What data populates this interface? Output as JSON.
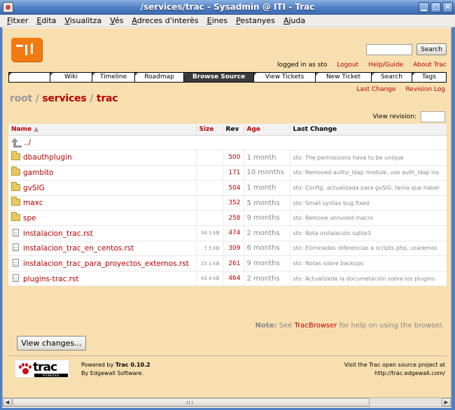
{
  "window": {
    "title": "/services/trac - Sysadmin @ ITI - Trac"
  },
  "menubar": {
    "items": [
      {
        "label": "Fitxer"
      },
      {
        "label": "Edita"
      },
      {
        "label": "Visualitza"
      },
      {
        "label": "Vés"
      },
      {
        "label": "Adreces d'interès"
      },
      {
        "label": "Eines"
      },
      {
        "label": "Pestanyes"
      },
      {
        "label": "Ajuda"
      }
    ]
  },
  "search": {
    "value": "",
    "button_label": "Search"
  },
  "metanav": {
    "logged_in": "logged in as sto",
    "logout": "Logout",
    "help": "Help/Guide",
    "about": "About Trac"
  },
  "mainnav": {
    "items": [
      {
        "label": ""
      },
      {
        "label": "Wiki"
      },
      {
        "label": "Timeline"
      },
      {
        "label": "Roadmap"
      },
      {
        "label": "Browse Source"
      },
      {
        "label": "View Tickets"
      },
      {
        "label": "New Ticket"
      },
      {
        "label": "Search"
      },
      {
        "label": "Tags"
      }
    ],
    "active_index": 4
  },
  "ctxnav": {
    "last_change": "Last Change",
    "revision_log": "Revision Log"
  },
  "path": {
    "root": "root",
    "sep1": "/",
    "part1": "services",
    "sep2": "/",
    "part2": "trac"
  },
  "view_revision": {
    "label": "View revision:",
    "value": ""
  },
  "listing": {
    "headers": {
      "name": "Name",
      "sort_indicator": "▲",
      "size": "Size",
      "rev": "Rev",
      "age": "Age",
      "change": "Last Change"
    },
    "parent": "../",
    "rows": [
      {
        "type": "dir",
        "name": "dbauthplugin",
        "size": "",
        "rev": "500",
        "age": "1 month",
        "change": "sto: The permissions have to be unique"
      },
      {
        "type": "dir",
        "name": "gambito",
        "size": "",
        "rev": "171",
        "age": "10 months",
        "change": "sto: Removed authz_ldap module, use auth_ldap ins"
      },
      {
        "type": "dir",
        "name": "gvSIG",
        "size": "",
        "rev": "504",
        "age": "1 month",
        "change": "sto: Config. actualizada para gvSIG, tenía que haber"
      },
      {
        "type": "dir",
        "name": "maxc",
        "size": "",
        "rev": "352",
        "age": "5 months",
        "change": "sto: Small syntax bug fixed"
      },
      {
        "type": "dir",
        "name": "spe",
        "size": "",
        "rev": "258",
        "age": "9 months",
        "change": "sto: Remove unnused macro"
      },
      {
        "type": "file",
        "name": "instalacion_trac.rst",
        "size": "34.3 kB",
        "rev": "474",
        "age": "2 months",
        "change": "sto: Nota instalación sqlite3"
      },
      {
        "type": "file",
        "name": "instalacion_trac_en_centos.rst",
        "size": "7.5 kB",
        "rev": "309",
        "age": "6 months",
        "change": "sto: Eliminadas referencias a scripts php, usaremos"
      },
      {
        "type": "file",
        "name": "instalacion_trac_para_proyectos_externos.rst",
        "size": "15.1 kB",
        "rev": "261",
        "age": "9 months",
        "change": "sto: Notas sobre backups"
      },
      {
        "type": "file",
        "name": "plugins-trac.rst",
        "size": "43.4 kB",
        "rev": "464",
        "age": "2 months",
        "change": "sto: Actualizada la documetación sobre los plugins"
      }
    ]
  },
  "note": {
    "label": "Note:",
    "text_before": "See",
    "link": "TracBrowser",
    "text_after": "for help on using the browser."
  },
  "view_changes_button": "View changes...",
  "footer": {
    "logo_word": "trac",
    "logo_powered": "POWERED",
    "powered_by": "Powered by",
    "version": "Trac 0.10.2",
    "by": "By Edgewall Software.",
    "visit": "Visit the Trac open source project at",
    "url": "http://trac.edgewall.com/"
  },
  "colors": {
    "page_bg": "#f8dfb0",
    "link": "#bb0000",
    "titlebar": "#4f7fc4",
    "logo": "#f27a12"
  }
}
